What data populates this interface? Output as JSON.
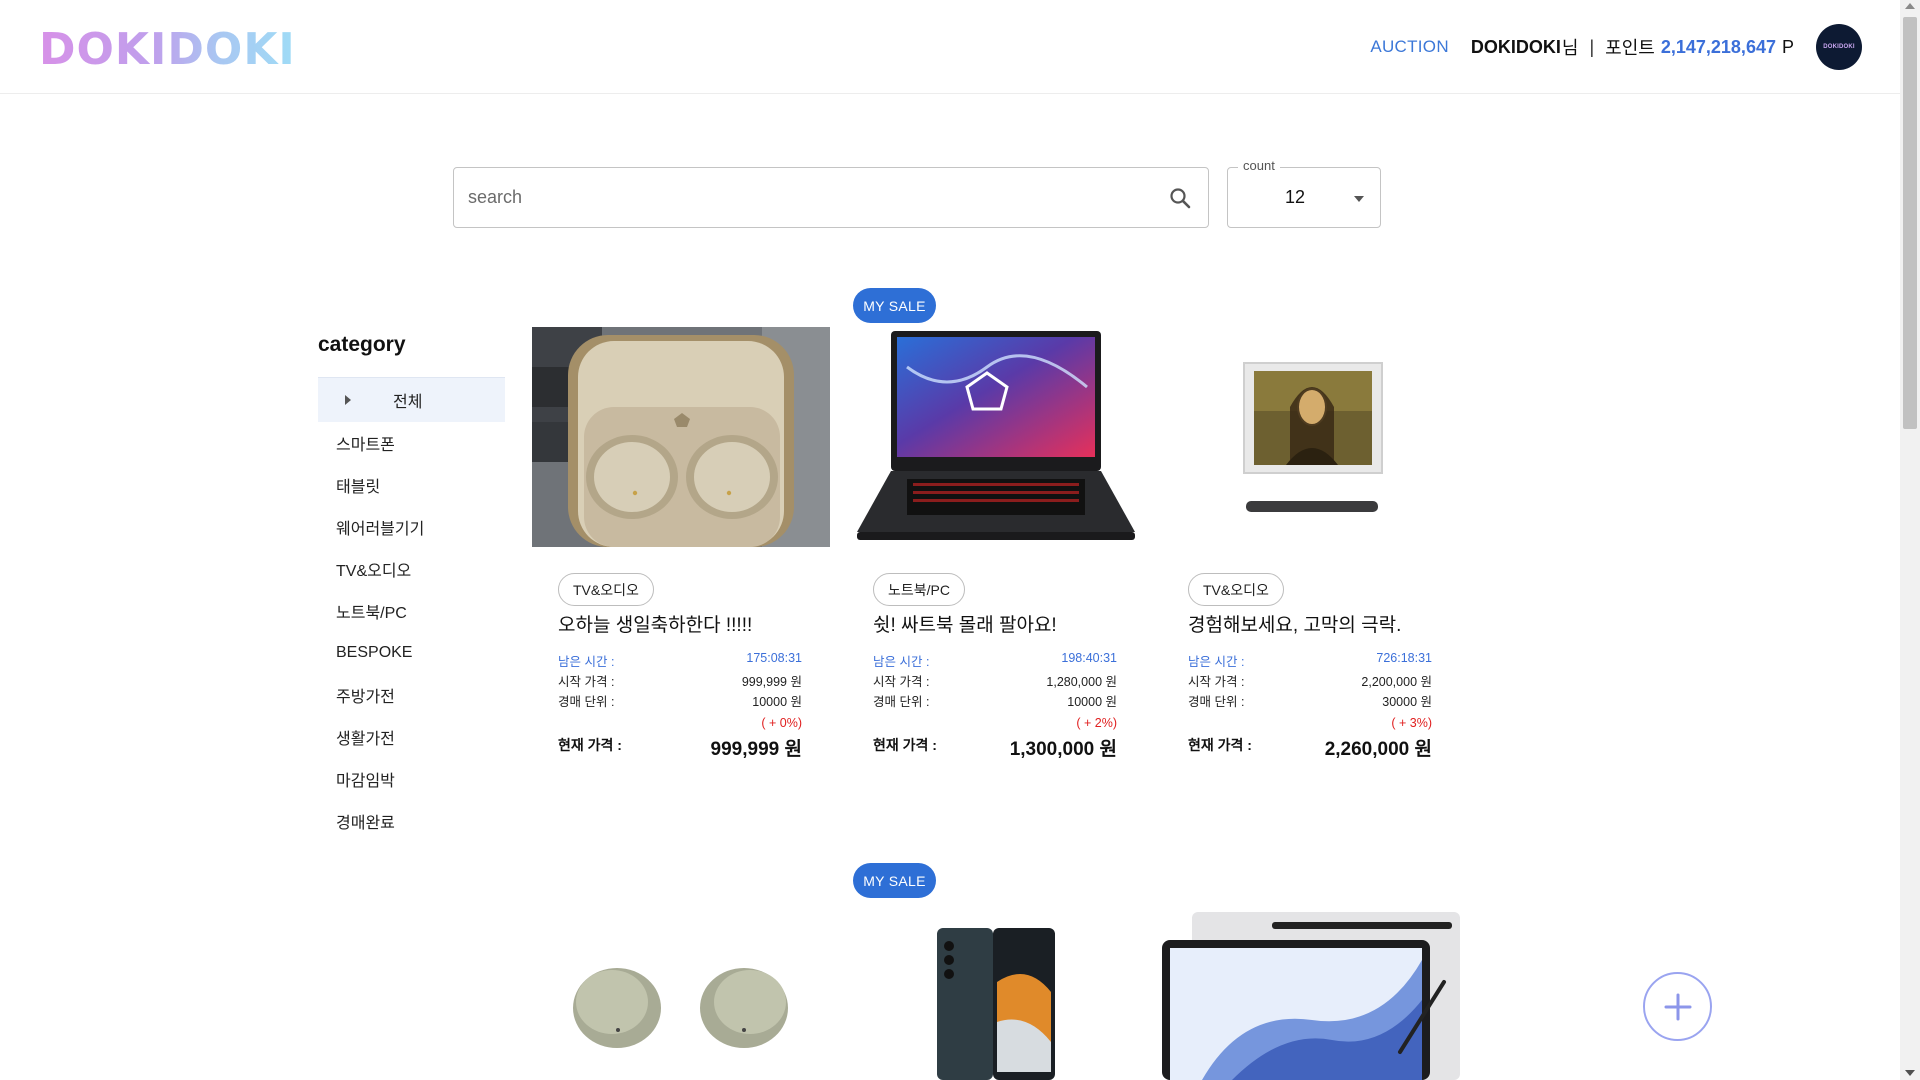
{
  "header": {
    "logo": "DOKIDOKI",
    "nav_auction": "AUCTION",
    "user_name": "DOKIDOKI",
    "user_suffix": "님",
    "separator": "|",
    "points_label": "포인트",
    "points_value": "2,147,218,647",
    "points_unit": "P",
    "avatar_text": "DOKIDOKI"
  },
  "search": {
    "placeholder": "search",
    "value": ""
  },
  "count": {
    "label": "count",
    "value": "12"
  },
  "sidebar": {
    "title": "category",
    "items": [
      {
        "label": "전체",
        "active": true
      },
      {
        "label": "스마트폰"
      },
      {
        "label": "태블릿"
      },
      {
        "label": "웨어러블기기"
      },
      {
        "label": "TV&오디오"
      },
      {
        "label": "노트북/PC"
      },
      {
        "label": "BESPOKE"
      },
      {
        "label": "주방가전"
      },
      {
        "label": "생활가전"
      },
      {
        "label": "마감임박"
      },
      {
        "label": "경매완료"
      }
    ]
  },
  "my_sale_badge": "MY SALE",
  "labels": {
    "remaining_time": "남은 시간 :",
    "start_price": "시작 가격 :",
    "bid_unit": "경매 단위 :",
    "current_price": "현재 가격 :"
  },
  "products": [
    {
      "category": "TV&오디오",
      "title": "오하늘 생일축하한다 !!!!!",
      "remaining_time": "175:08:31",
      "start_price": "999,999 원",
      "bid_unit": "10000 원",
      "change": "( + 0%)",
      "current_price": "999,999 원",
      "image": "earbuds-case-photo"
    },
    {
      "category": "노트북/PC",
      "title": "쉿! 싸트북 몰래 팔아요!",
      "remaining_time": "198:40:31",
      "start_price": "1,280,000 원",
      "bid_unit": "10000 원",
      "change": "( + 2%)",
      "current_price": "1,300,000 원",
      "image": "gaming-laptop"
    },
    {
      "category": "TV&오디오",
      "title": "경험해보세요, 고막의 극락.",
      "remaining_time": "726:18:31",
      "start_price": "2,200,000 원",
      "bid_unit": "30000 원",
      "change": "( + 3%)",
      "current_price": "2,260,000 원",
      "image": "frame-tv-mona-lisa"
    }
  ],
  "second_row_images": [
    "galaxy-buds",
    "galaxy-fold",
    "galaxy-tab"
  ],
  "colors": {
    "accent": "#2e6fd6",
    "price_change": "#e02020",
    "points": "#3b6fd9"
  }
}
